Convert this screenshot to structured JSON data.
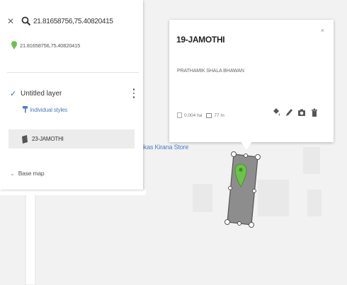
{
  "search": {
    "query": "21.81658756,75.40820415",
    "close_icon": "close-icon",
    "search_icon": "search-icon"
  },
  "result": {
    "text": "21.81658756,75.40820415",
    "marker_icon": "map-pin-icon",
    "marker_color": "#6cc24a"
  },
  "layer": {
    "title": "Untitled layer",
    "styles_label": "Individual styles",
    "feature_label": "23-JAMOTHI",
    "checked": true
  },
  "basemap": {
    "label": "Base map"
  },
  "map": {
    "place_label": "ikas Kirana Store",
    "polygon_fill": "#8d8d8d",
    "marker_color": "#6cc24a"
  },
  "popup": {
    "title": "19-JAMOTHI",
    "description": "PRATHAMIK SHALA BHAWAN",
    "area": "0.004 ha",
    "perimeter": "77 m",
    "close": "×",
    "actions": [
      "paint-bucket-icon",
      "pencil-icon",
      "camera-icon",
      "trash-icon"
    ]
  },
  "colors": {
    "accent": "#3367d6",
    "link": "#4b7fc4",
    "panel_bg": "#ffffff",
    "map_bg": "#f2f2f2"
  }
}
